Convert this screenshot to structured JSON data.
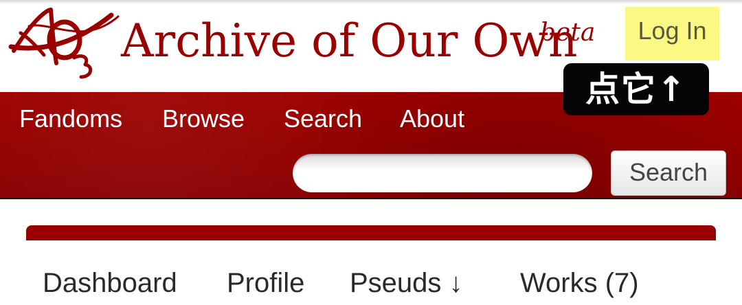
{
  "header": {
    "logo_icon": "ao3-logo-icon",
    "site_title": "Archive of Our Own",
    "beta_label": "beta",
    "login_label": "Log In",
    "annotation": "点它↑"
  },
  "nav": {
    "items": [
      "Fandoms",
      "Browse",
      "Search",
      "About"
    ],
    "search_placeholder": "",
    "search_button": "Search"
  },
  "user_nav": {
    "items": [
      "Dashboard",
      "Profile",
      "Pseuds ↓",
      "Works (7)"
    ]
  },
  "colors": {
    "brand_red": "#990000",
    "highlight_yellow": "#fbf983",
    "annotation_bg": "#050505"
  }
}
